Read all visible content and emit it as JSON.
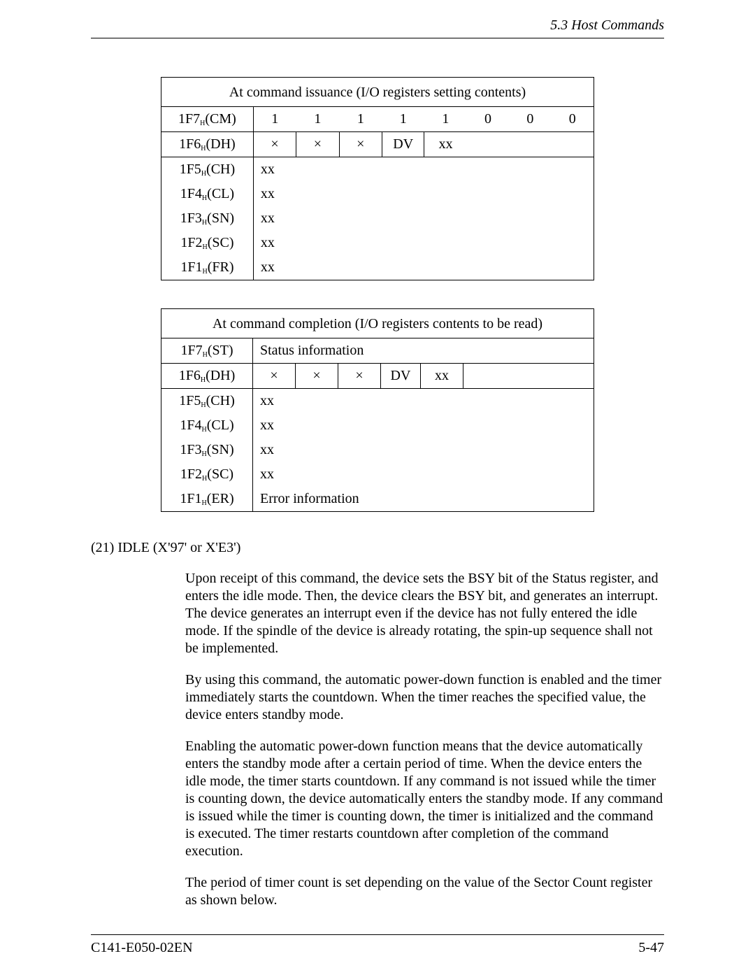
{
  "header": {
    "section_label": "5.3  Host Commands"
  },
  "tables": {
    "issuance": {
      "title": "At command issuance (I/O registers setting contents)",
      "rows": {
        "CM": {
          "label": "1F7",
          "sub": "H",
          "suffix": "(CM)",
          "bits": [
            "1",
            "1",
            "1",
            "1",
            "1",
            "0",
            "0",
            "0"
          ]
        },
        "DH": {
          "label": "1F6",
          "sub": "H",
          "suffix": "(DH)",
          "cells": [
            "×",
            "×",
            "×",
            "DV",
            "xx"
          ]
        },
        "CH": {
          "label": "1F5",
          "sub": "H",
          "suffix": "(CH)",
          "val": "xx"
        },
        "CL": {
          "label": "1F4",
          "sub": "H",
          "suffix": "(CL)",
          "val": "xx"
        },
        "SN": {
          "label": "1F3",
          "sub": "H",
          "suffix": "(SN)",
          "val": "xx"
        },
        "SC": {
          "label": "1F2",
          "sub": "H",
          "suffix": "(SC)",
          "val": "xx"
        },
        "FR": {
          "label": "1F1",
          "sub": "H",
          "suffix": "(FR)",
          "val": "xx"
        }
      }
    },
    "completion": {
      "title": "At command completion (I/O registers contents to be read)",
      "rows": {
        "ST": {
          "label": "1F7",
          "sub": "H",
          "suffix": "(ST)",
          "val": "Status information"
        },
        "DH": {
          "label": "1F6",
          "sub": "H",
          "suffix": "(DH)",
          "cells": [
            "×",
            "×",
            "×",
            "DV",
            "xx"
          ]
        },
        "CH": {
          "label": "1F5",
          "sub": "H",
          "suffix": "(CH)",
          "val": "xx"
        },
        "CL": {
          "label": "1F4",
          "sub": "H",
          "suffix": "(CL)",
          "val": "xx"
        },
        "SN": {
          "label": "1F3",
          "sub": "H",
          "suffix": "(SN)",
          "val": "xx"
        },
        "SC": {
          "label": "1F2",
          "sub": "H",
          "suffix": "(SC)",
          "val": "xx"
        },
        "ER": {
          "label": "1F1",
          "sub": "H",
          "suffix": "(ER)",
          "val": "Error information"
        }
      }
    }
  },
  "section": {
    "heading": "(21)  IDLE (X'97' or X'E3')"
  },
  "paragraphs": {
    "p1": "Upon receipt of this command, the device sets the BSY bit of the Status register, and enters the idle mode. Then, the device clears the BSY bit, and generates an interrupt. The device generates an interrupt even if the device has not fully entered the idle mode.  If the spindle of the device is already rotating, the spin-up sequence shall not be implemented.",
    "p2": "By using this command, the automatic power-down function is enabled and the timer immediately starts the countdown.  When the timer reaches the specified value, the device enters standby mode.",
    "p3": "Enabling the automatic power-down function means that the device automatically enters the standby mode after a certain period of time.  When the device enters the idle mode, the timer starts countdown. If any command is not issued while the timer is counting down, the device automatically enters the standby mode.  If any command is issued while the timer is counting down, the timer is initialized and the command is executed. The timer restarts countdown after completion of the command execution.",
    "p4": "The period of timer count is set depending on the value of the Sector Count register as shown below."
  },
  "footer": {
    "doc_id": "C141-E050-02EN",
    "page": "5-47"
  }
}
